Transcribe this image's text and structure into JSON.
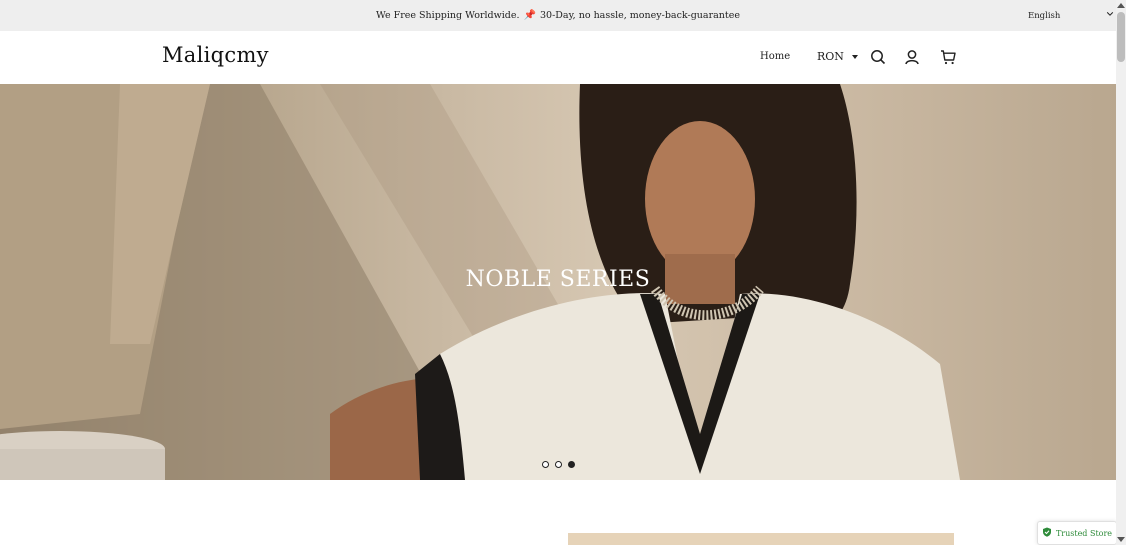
{
  "announcement": {
    "text_before": "We Free Shipping Worldwide.",
    "pin_icon": "📌",
    "text_after": "30-Day, no hassle, money-back-guarantee"
  },
  "language": {
    "selected": "English",
    "icon": "chevron-down-icon"
  },
  "header": {
    "logo": "Maliqcmy",
    "nav_home": "Home",
    "currency": "RON",
    "icons": [
      "search-icon",
      "account-icon",
      "cart-icon"
    ]
  },
  "hero": {
    "title": "NOBLE SERIES",
    "slides_total": 3,
    "active_slide": 3
  },
  "badge": {
    "label": "Trusted Store",
    "icon": "shield-check-icon",
    "color": "#2e8b3a"
  }
}
